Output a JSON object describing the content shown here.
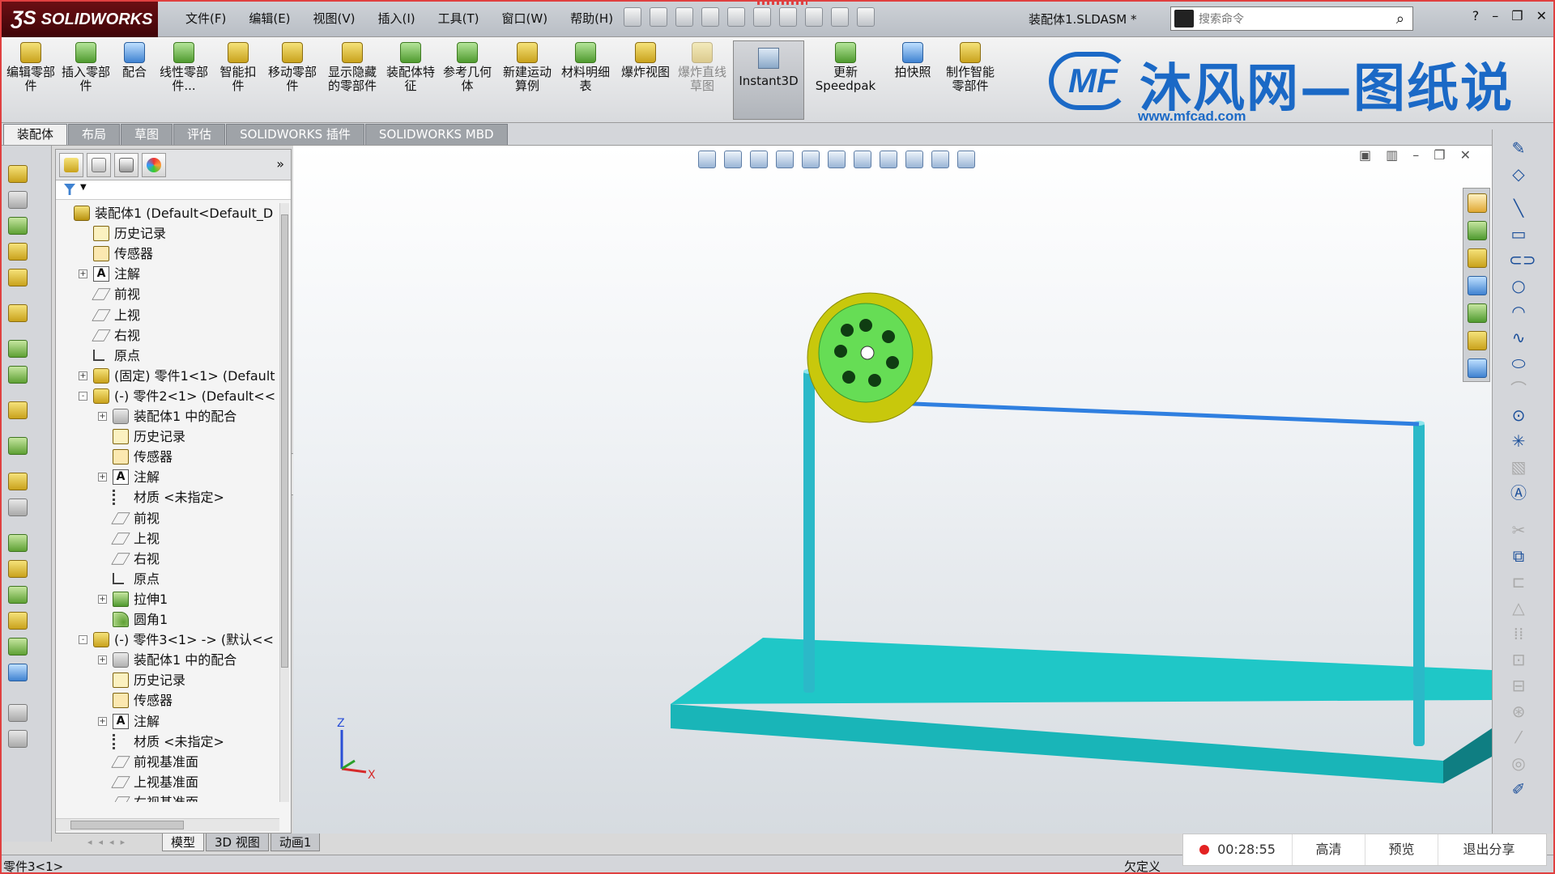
{
  "app": {
    "logo_text": "SOLIDWORKS",
    "menu": [
      "文件(F)",
      "编辑(E)",
      "视图(V)",
      "插入(I)",
      "工具(T)",
      "窗口(W)",
      "帮助(H)"
    ],
    "document_title": "装配体1.SLDASM *",
    "search_placeholder": "搜索命令"
  },
  "ribbon": {
    "buttons": [
      {
        "label": "编辑零部件",
        "icon": "edit-component-icon"
      },
      {
        "label": "插入零部件",
        "icon": "insert-component-icon"
      },
      {
        "label": "配合",
        "icon": "mate-icon"
      },
      {
        "label": "线性零部件...",
        "icon": "linear-pattern-icon"
      },
      {
        "label": "智能扣件",
        "icon": "smart-fasteners-icon"
      },
      {
        "label": "移动零部件",
        "icon": "move-component-icon"
      },
      {
        "label": "显示隐藏的零部件",
        "icon": "show-hidden-icon"
      },
      {
        "label": "装配体特征",
        "icon": "assembly-features-icon"
      },
      {
        "label": "参考几何体",
        "icon": "reference-geometry-icon"
      },
      {
        "label": "新建运动算例",
        "icon": "new-motion-study-icon"
      },
      {
        "label": "材料明细表",
        "icon": "bom-icon"
      },
      {
        "label": "爆炸视图",
        "icon": "exploded-view-icon"
      },
      {
        "label": "爆炸直线草图",
        "icon": "explode-line-sketch-icon"
      },
      {
        "label": "Instant3D",
        "icon": "instant3d-icon"
      },
      {
        "label": "更新Speedpak",
        "icon": "speedpak-icon"
      },
      {
        "label": "拍快照",
        "icon": "snapshot-icon"
      },
      {
        "label": "制作智能零部件",
        "icon": "smart-component-icon"
      }
    ],
    "watermark": {
      "brand": "MF",
      "title": "沐风网—图纸说",
      "url": "www.mfcad.com"
    }
  },
  "command_tabs": [
    "装配体",
    "布局",
    "草图",
    "评估",
    "SOLIDWORKS 插件",
    "SOLIDWORKS MBD"
  ],
  "feature_tree": [
    {
      "label": "装配体1  (Default<Default_D",
      "icon": "asm",
      "level": 0,
      "expander": ""
    },
    {
      "label": "历史记录",
      "icon": "hist",
      "level": 1,
      "expander": ""
    },
    {
      "label": "传感器",
      "icon": "sens",
      "level": 1,
      "expander": ""
    },
    {
      "label": "注解",
      "icon": "note",
      "level": 1,
      "expander": "+"
    },
    {
      "label": "前视",
      "icon": "plane",
      "level": 1,
      "expander": ""
    },
    {
      "label": "上视",
      "icon": "plane",
      "level": 1,
      "expander": ""
    },
    {
      "label": "右视",
      "icon": "plane",
      "level": 1,
      "expander": ""
    },
    {
      "label": "原点",
      "icon": "origin",
      "level": 1,
      "expander": ""
    },
    {
      "label": "(固定) 零件1<1> (Default",
      "icon": "part",
      "level": 1,
      "expander": "+"
    },
    {
      "label": "(-) 零件2<1> (Default<<",
      "icon": "part",
      "level": 1,
      "expander": "-"
    },
    {
      "label": "装配体1 中的配合",
      "icon": "mate",
      "level": 2,
      "expander": "+"
    },
    {
      "label": "历史记录",
      "icon": "hist",
      "level": 2,
      "expander": ""
    },
    {
      "label": "传感器",
      "icon": "sens",
      "level": 2,
      "expander": ""
    },
    {
      "label": "注解",
      "icon": "note",
      "level": 2,
      "expander": "+"
    },
    {
      "label": "材质 <未指定>",
      "icon": "mat",
      "level": 2,
      "expander": ""
    },
    {
      "label": "前视",
      "icon": "plane",
      "level": 2,
      "expander": ""
    },
    {
      "label": "上视",
      "icon": "plane",
      "level": 2,
      "expander": ""
    },
    {
      "label": "右视",
      "icon": "plane",
      "level": 2,
      "expander": ""
    },
    {
      "label": "原点",
      "icon": "origin",
      "level": 2,
      "expander": ""
    },
    {
      "label": "拉伸1",
      "icon": "ext",
      "level": 2,
      "expander": "+"
    },
    {
      "label": "圆角1",
      "icon": "fillet",
      "level": 2,
      "expander": ""
    },
    {
      "label": "(-) 零件3<1> -> (默认<<",
      "icon": "part",
      "level": 1,
      "expander": "-"
    },
    {
      "label": "装配体1 中的配合",
      "icon": "mate",
      "level": 2,
      "expander": "+"
    },
    {
      "label": "历史记录",
      "icon": "hist",
      "level": 2,
      "expander": ""
    },
    {
      "label": "传感器",
      "icon": "sens",
      "level": 2,
      "expander": ""
    },
    {
      "label": "注解",
      "icon": "note",
      "level": 2,
      "expander": "+"
    },
    {
      "label": "材质 <未指定>",
      "icon": "mat",
      "level": 2,
      "expander": ""
    },
    {
      "label": "前视基准面",
      "icon": "plane",
      "level": 2,
      "expander": ""
    },
    {
      "label": "上视基准面",
      "icon": "plane",
      "level": 2,
      "expander": ""
    },
    {
      "label": "右视基准面",
      "icon": "plane",
      "level": 2,
      "expander": ""
    }
  ],
  "viewport": {
    "triad_z": "Z",
    "triad_x": "X",
    "colors": {
      "base": "#1fc7c7",
      "post": "#2bb9c8",
      "wire": "#2f7fe0",
      "wheel_rim": "#c8c80c",
      "wheel_face": "#66dd55",
      "wheel_holes": "#0f3d12"
    }
  },
  "bottom_tabs": [
    "模型",
    "3D 视图",
    "动画1"
  ],
  "status": {
    "left": "零件3<1>",
    "right": "欠定义"
  },
  "recording": {
    "time": "00:28:55",
    "hd": "高清",
    "preview": "预览",
    "exit": "退出分享"
  }
}
